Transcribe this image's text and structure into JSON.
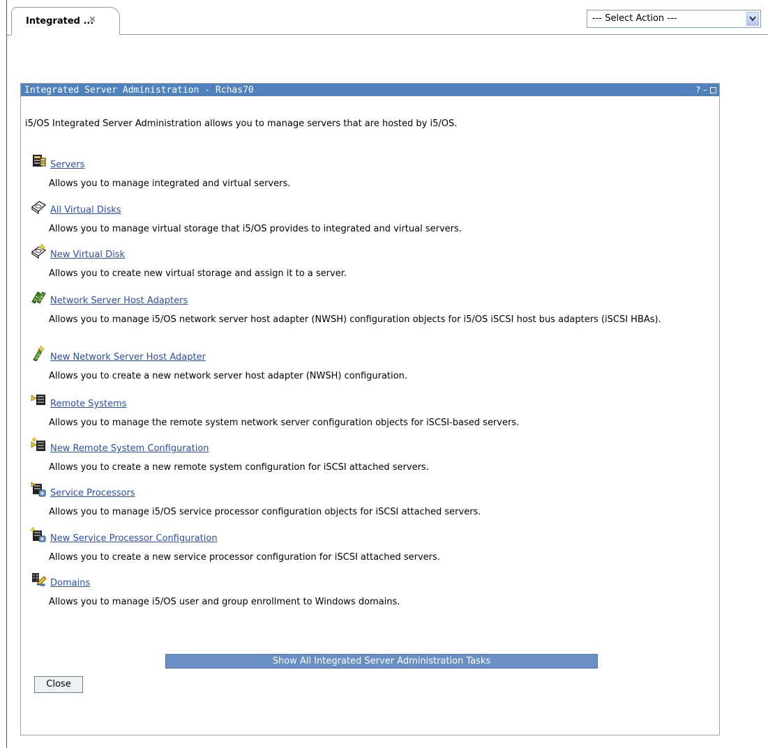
{
  "tab": {
    "label": "Integrated ...",
    "close_glyph": "✕"
  },
  "select_action": {
    "value": "--- Select Action ---"
  },
  "portlet": {
    "title": "Integrated Server Administration - Rchas70",
    "controls": {
      "help": "?",
      "minimize": "–"
    },
    "intro": "i5/OS Integrated Server Administration allows you to manage servers that are hosted by i5/OS.",
    "items": [
      {
        "icon": "servers-icon",
        "label": "Servers",
        "description": "Allows you to manage integrated and virtual servers."
      },
      {
        "icon": "virtual-disks-icon",
        "label": "All Virtual Disks",
        "description": "Allows you to manage virtual storage that i5/OS provides to integrated and virtual servers."
      },
      {
        "icon": "new-virtual-disk-icon",
        "label": "New Virtual Disk",
        "description": "Allows you to create new virtual storage and assign it to a server."
      },
      {
        "icon": "host-adapters-icon",
        "label": "Network Server Host Adapters",
        "description": "Allows you to manage i5/OS network server host adapter (NWSH) configuration objects for i5/OS iSCSI host bus adapters (iSCSI HBAs)."
      },
      {
        "icon": "new-host-adapter-icon",
        "label": "New Network Server Host Adapter",
        "description": "Allows you to create a new network server host adapter (NWSH) configuration."
      },
      {
        "icon": "remote-systems-icon",
        "label": "Remote Systems",
        "description": "Allows you to manage the remote system network server configuration objects for iSCSI-based servers."
      },
      {
        "icon": "new-remote-system-icon",
        "label": "New Remote System Configuration",
        "description": "Allows you to create a new remote system configuration for iSCSI attached servers."
      },
      {
        "icon": "service-processors-icon",
        "label": "Service Processors",
        "description": "Allows you to manage i5/OS service processor configuration objects for iSCSI attached servers."
      },
      {
        "icon": "new-service-processor-icon",
        "label": "New Service Processor Configuration",
        "description": "Allows you to create a new service processor configuration for iSCSI attached servers."
      },
      {
        "icon": "domains-icon",
        "label": "Domains",
        "description": "Allows you to manage i5/OS user and group enrollment to Windows domains."
      }
    ],
    "show_all_label": "Show All Integrated Server Administration Tasks",
    "close_label": "Close"
  },
  "colors": {
    "title_bar": "#4f81bd",
    "link": "#2b4fa8",
    "show_all_button": "#6a8fc4"
  }
}
